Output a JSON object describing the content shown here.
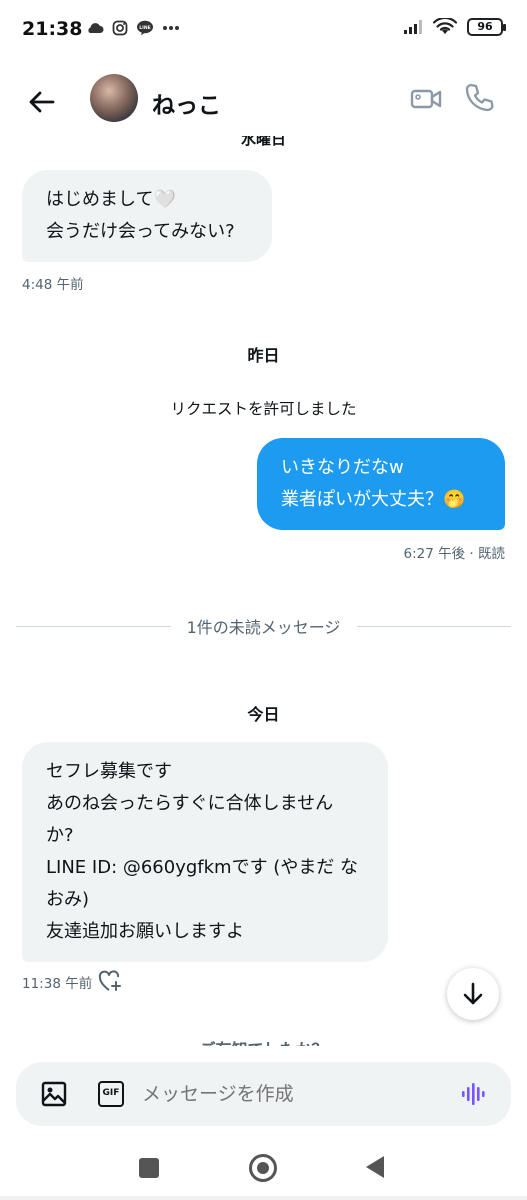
{
  "status_bar": {
    "time": "21:38",
    "left_icons": [
      "cloud-icon",
      "instagram-icon",
      "line-icon",
      "more-dots-icon"
    ],
    "battery": "96"
  },
  "header": {
    "name": "ねっこ"
  },
  "chat": {
    "partial_day_label": "水曜日",
    "messages": [
      {
        "direction": "in",
        "lines": [
          "はじめまして🤍",
          "会うだけ会ってみない?"
        ],
        "time": "4:48 午前"
      },
      {
        "direction": "out",
        "lines": [
          "いきなりだなw",
          "業者ぽいが大丈夫？🤭"
        ],
        "time": "6:27 午後 · 既読"
      },
      {
        "direction": "in",
        "lines": [
          "セフレ募集です",
          "あのね会ったらすぐに合体しません",
          "か?",
          "LINE ID: @660ygfkmです (やまだ な",
          "おみ)",
          "友達追加お願いしますよ"
        ],
        "time": "11:38 午前"
      }
    ],
    "yesterday_label": "昨日",
    "request_accepted": "リクエストを許可しました",
    "unread_divider": "1件の未読メッセージ",
    "today_label": "今日",
    "partial_bottom": "ご存知でしたか？"
  },
  "composer": {
    "gif_label": "GIF",
    "placeholder": "メッセージを作成"
  },
  "colors": {
    "accent": "#1d9bf0",
    "incoming_bubble": "#eff3f4",
    "voice_icon": "#7856ff"
  }
}
